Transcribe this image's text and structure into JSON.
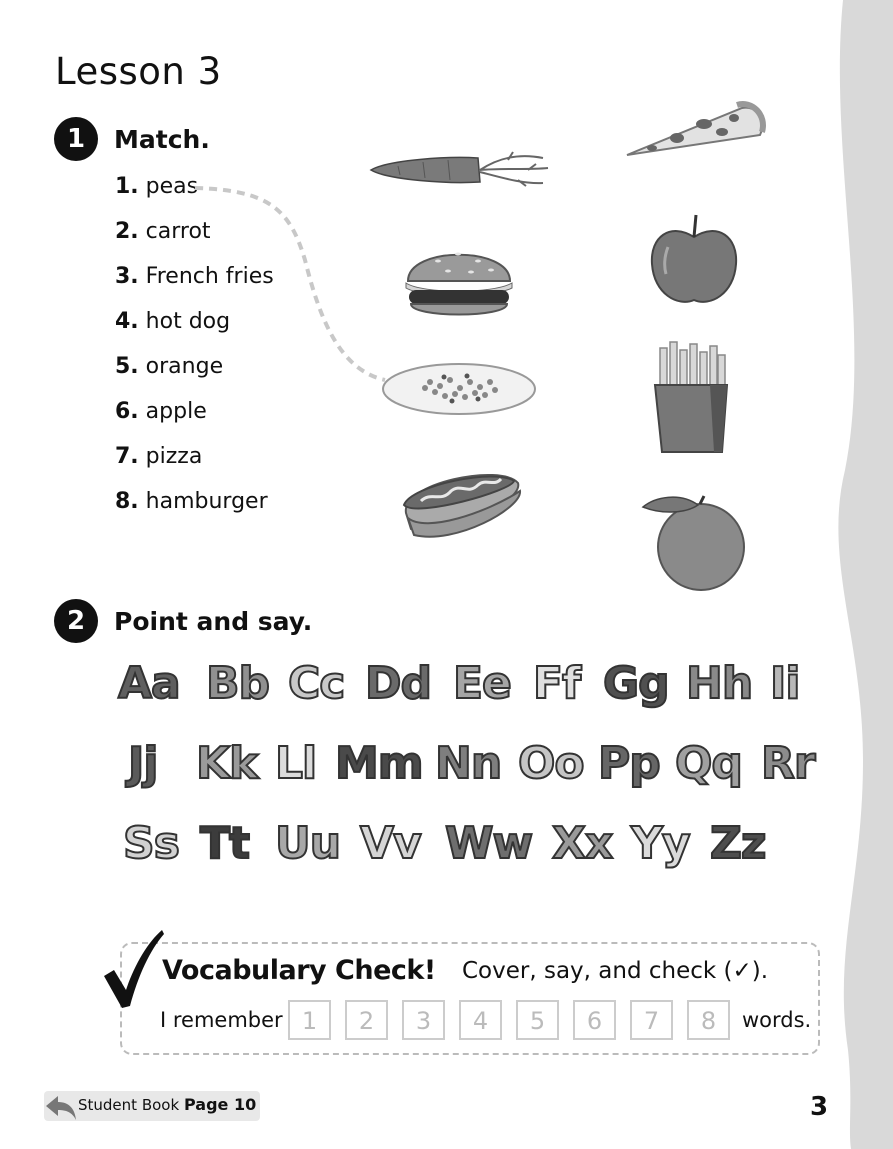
{
  "title": "Lesson 3",
  "section1": {
    "number": "1",
    "heading": "Match."
  },
  "items": [
    {
      "num": "1.",
      "word": "peas"
    },
    {
      "num": "2.",
      "word": "carrot"
    },
    {
      "num": "3.",
      "word": "French fries"
    },
    {
      "num": "4.",
      "word": "hot dog"
    },
    {
      "num": "5.",
      "word": "orange"
    },
    {
      "num": "6.",
      "word": "apple"
    },
    {
      "num": "7.",
      "word": "pizza"
    },
    {
      "num": "8.",
      "word": "hamburger"
    }
  ],
  "pictures": [
    "carrot-illustration",
    "pizza-illustration",
    "hamburger-illustration",
    "apple-illustration",
    "peas-illustration",
    "french-fries-illustration",
    "hot-dog-illustration",
    "orange-illustration"
  ],
  "section2": {
    "number": "2",
    "heading": "Point and say."
  },
  "alphabet_rows": [
    [
      "Aa",
      "Bb",
      "Cc",
      "Dd",
      "Ee",
      "Ff",
      "Gg",
      "Hh",
      "Ii"
    ],
    [
      "Jj",
      "Kk",
      "Ll",
      "Mm",
      "Nn",
      "Oo",
      "Pp",
      "Qq",
      "Rr"
    ],
    [
      "Ss",
      "Tt",
      "Uu",
      "Vv",
      "Ww",
      "Xx",
      "Yy",
      "Zz"
    ]
  ],
  "vocab_check": {
    "title": "Vocabulary Check!",
    "instruction": "Cover, say, and check (✓).",
    "remember_label": "I remember",
    "boxes": [
      "1",
      "2",
      "3",
      "4",
      "5",
      "6",
      "7",
      "8"
    ],
    "words_label": "words."
  },
  "footer": {
    "book_label": "Student Book",
    "page_label": "Page 10",
    "page_number": "3"
  },
  "colors": {
    "accent": "#111111",
    "page_edge": "#d9d9d9"
  }
}
